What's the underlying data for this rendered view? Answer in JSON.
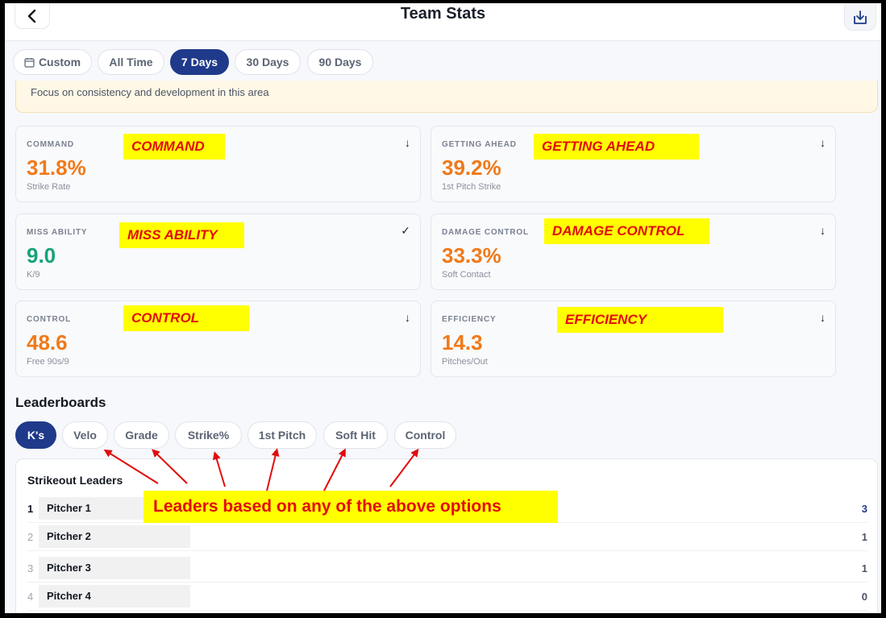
{
  "header": {
    "title": "Team Stats",
    "back_icon": "chevron-left-icon",
    "download_icon": "download-icon"
  },
  "time_range": {
    "options": [
      {
        "label": "Custom",
        "icon": "calendar-icon"
      },
      {
        "label": "All Time"
      },
      {
        "label": "7 Days",
        "active": true
      },
      {
        "label": "30 Days"
      },
      {
        "label": "90 Days"
      }
    ]
  },
  "banner": {
    "text": "Focus on consistency and development in this area"
  },
  "metrics": [
    {
      "label": "COMMAND",
      "value": "31.8%",
      "sub": "Strike Rate",
      "status": "↓",
      "annotation": "COMMAND",
      "color": "#f07a1a"
    },
    {
      "label": "GETTING AHEAD",
      "value": "39.2%",
      "sub": "1st Pitch Strike",
      "status": "↓",
      "annotation": "GETTING AHEAD",
      "color": "#f07a1a"
    },
    {
      "label": "MISS ABILITY",
      "value": "9.0",
      "sub": "K/9",
      "status": "✓",
      "annotation": "MISS ABILITY",
      "color": "#16a37a"
    },
    {
      "label": "DAMAGE CONTROL",
      "value": "33.3%",
      "sub": "Soft Contact",
      "status": "↓",
      "annotation": "DAMAGE CONTROL",
      "color": "#f07a1a"
    },
    {
      "label": "CONTROL",
      "value": "48.6",
      "sub": "Free 90s/9",
      "status": "↓",
      "annotation": "CONTROL",
      "color": "#f07a1a"
    },
    {
      "label": "EFFICIENCY",
      "value": "14.3",
      "sub": "Pitches/Out",
      "status": "↓",
      "annotation": "EFFICIENCY",
      "color": "#f07a1a"
    }
  ],
  "leaderboards": {
    "title": "Leaderboards",
    "tabs": [
      {
        "label": "K's",
        "active": true
      },
      {
        "label": "Velo"
      },
      {
        "label": "Grade"
      },
      {
        "label": "Strike%"
      },
      {
        "label": "1st Pitch"
      },
      {
        "label": "Soft Hit"
      },
      {
        "label": "Control"
      }
    ],
    "panel_title": "Strikeout Leaders",
    "rows": [
      {
        "rank": "1",
        "name": "Pitcher 1",
        "score": "3"
      },
      {
        "rank": "2",
        "name": "Pitcher 2",
        "score": "1"
      },
      {
        "rank": "3",
        "name": "Pitcher 3",
        "score": "1"
      },
      {
        "rank": "4",
        "name": "Pitcher 4",
        "score": "0"
      }
    ],
    "annotation": "Leaders based on any of the above options"
  },
  "colors": {
    "accent": "#1f3a8a",
    "warning": "#f07a1a",
    "good": "#16a37a",
    "annotation_bg": "#ffff00",
    "annotation_text": "#e20c0c"
  }
}
